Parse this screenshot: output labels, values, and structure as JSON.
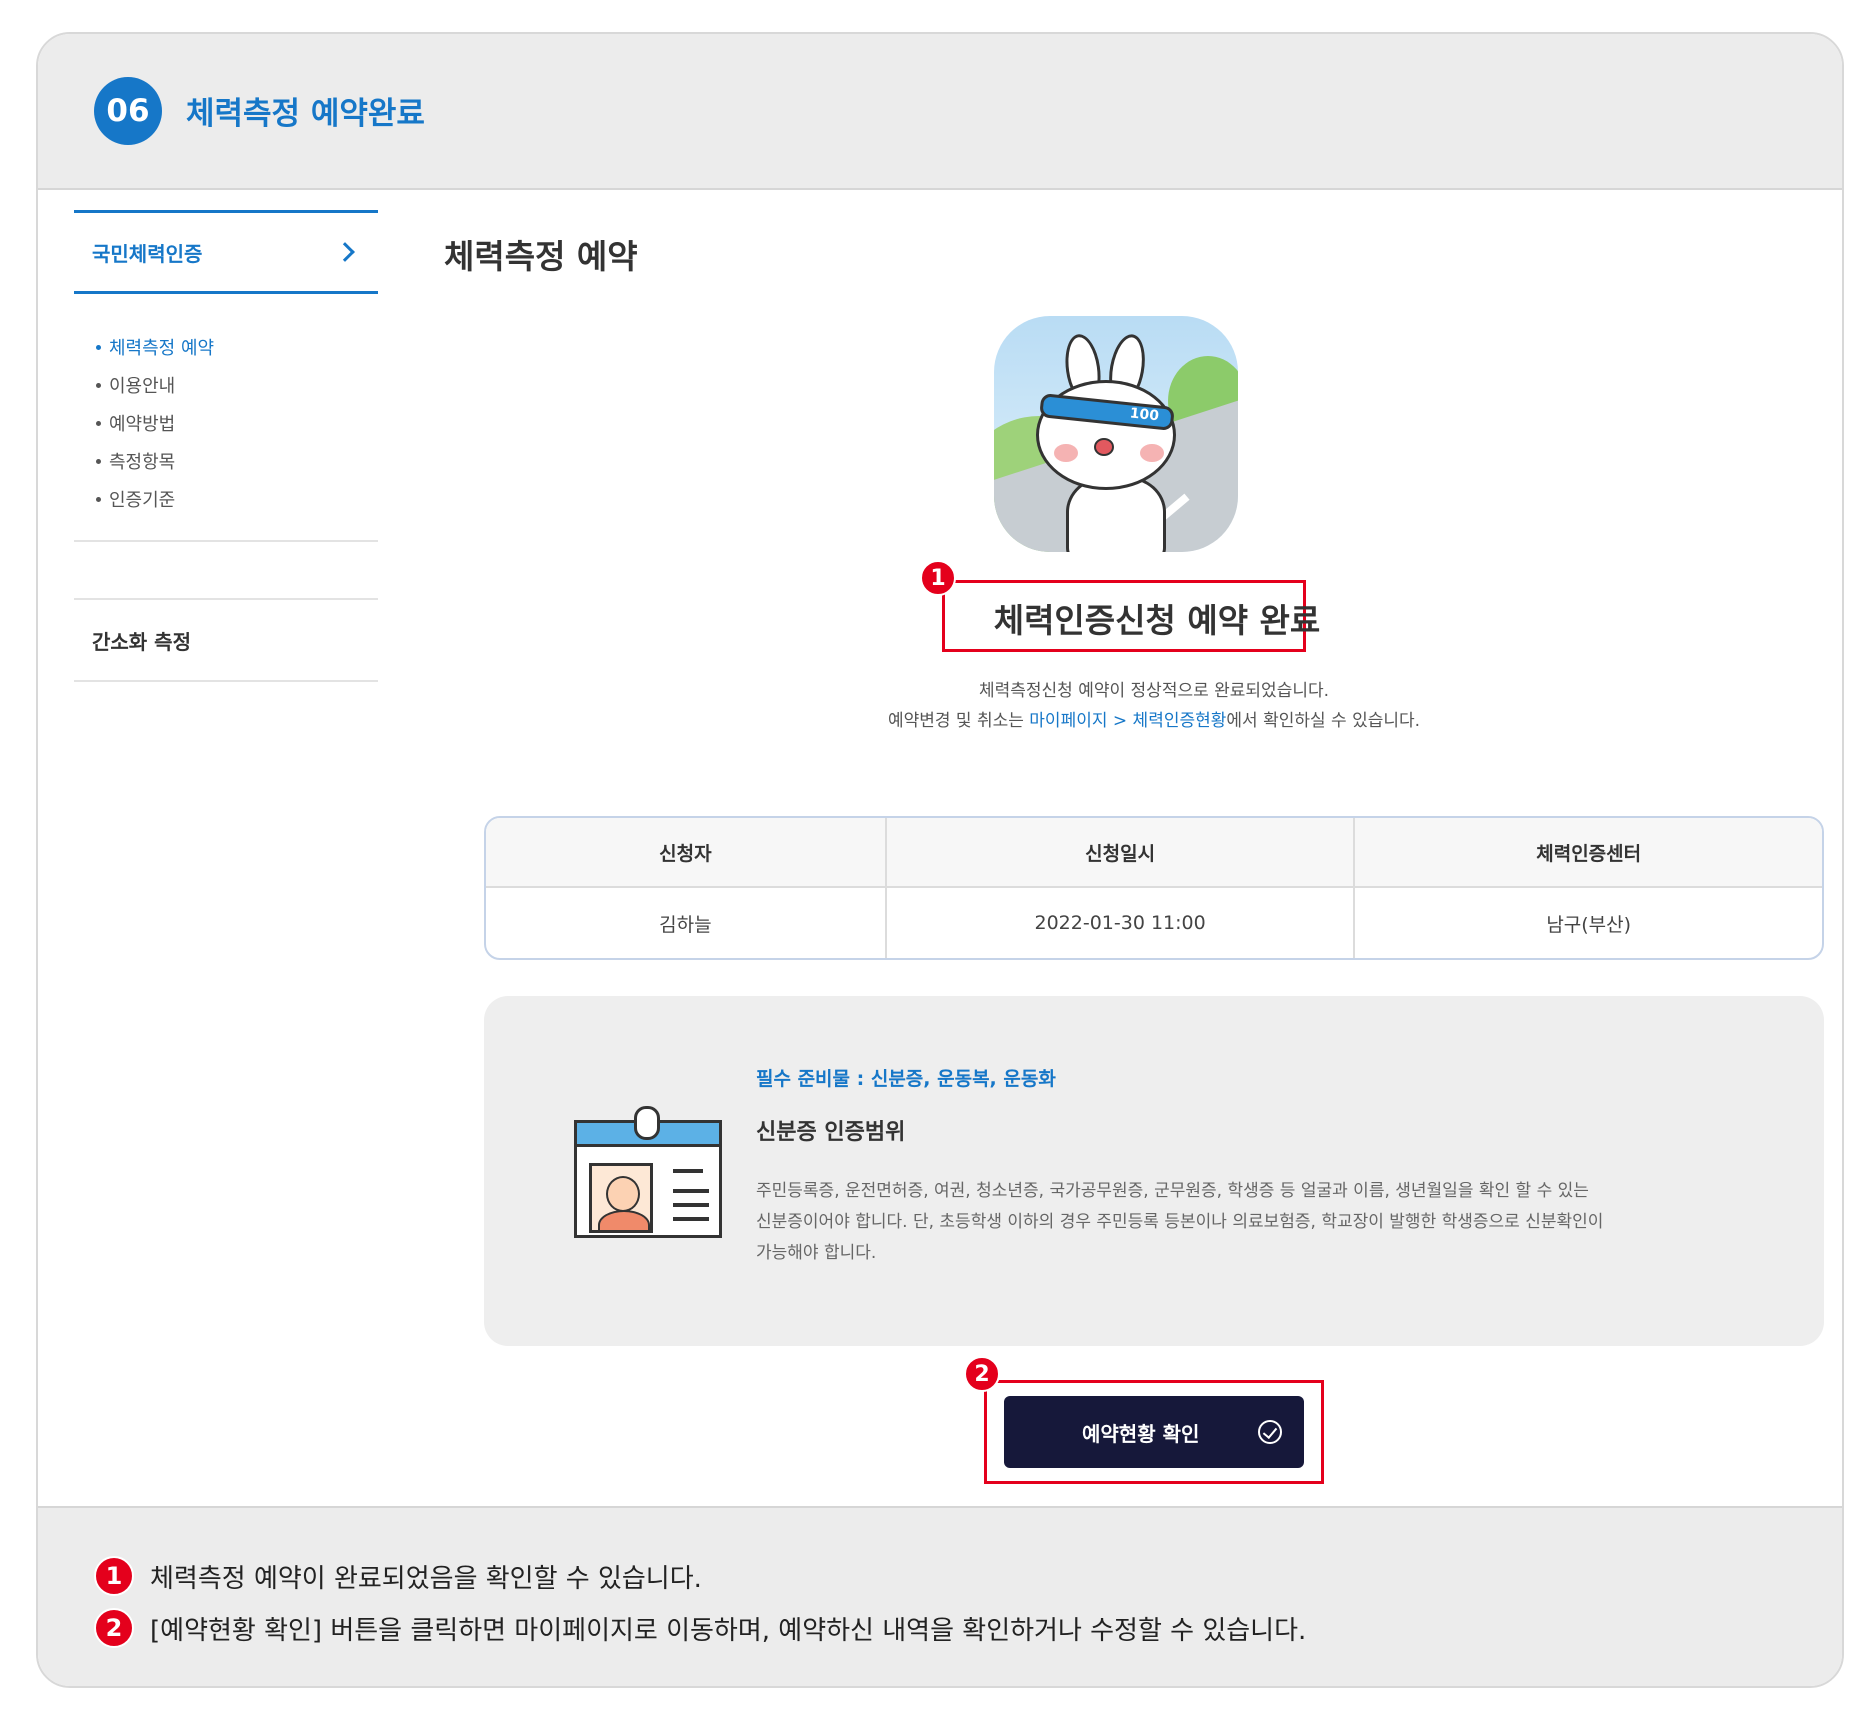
{
  "header": {
    "step_number": "06",
    "title": "체력측정 예약완료"
  },
  "sidebar": {
    "section_title": "국민체력인증",
    "items": [
      {
        "label": "체력측정 예약",
        "active": true
      },
      {
        "label": "이용안내",
        "active": false
      },
      {
        "label": "예약방법",
        "active": false
      },
      {
        "label": "측정항목",
        "active": false
      },
      {
        "label": "인증기준",
        "active": false
      }
    ],
    "section2_title": "간소화 측정"
  },
  "main": {
    "page_title": "체력측정 예약",
    "mascot_band_text": "100",
    "completion_title": "체력인증신청 예약 완료",
    "desc_line1": "체력측정신청 예약이 정상적으로 완료되었습니다.",
    "desc_line2_prefix": "예약변경 및 취소는 ",
    "desc_line2_link": "마이페이지 > 체력인증현황",
    "desc_line2_suffix": "에서 확인하실 수 있습니다.",
    "table": {
      "headers": [
        "신청자",
        "신청일시",
        "체력인증센터"
      ],
      "row": [
        "김하늘",
        "2022-01-30 11:00",
        "남구(부산)"
      ]
    },
    "notice": {
      "required_items": "필수 준비물 : 신분증, 운동복, 운동화",
      "heading": "신분증 인증범위",
      "body_line1": "주민등록증, 운전면허증, 여권, 청소년증, 국가공무원증, 군무원증, 학생증 등 얼굴과 이름, 생년월일을 확인 할 수 있는",
      "body_line2": "신분증이어야 합니다. 단, 초등학생 이하의 경우 주민등록 등본이나 의료보험증, 학교장이 발행한 학생증으로 신분확인이",
      "body_line3": "가능해야 합니다."
    },
    "confirm_button_label": "예약현황 확인"
  },
  "annotations": {
    "badge1": "1",
    "badge2": "2",
    "note1": "체력측정 예약이 완료되었음을 확인할 수 있습니다.",
    "note2": "[예약현황 확인] 버튼을 클릭하면 마이페이지로 이동하며, 예약하신 내역을 확인하거나 수정할 수 있습니다."
  },
  "colors": {
    "accent": "#1677c8",
    "badge_red": "#e4001c",
    "button_dark": "#16183a"
  },
  "icons": {
    "sidebar_arrow": "chevron-right-icon",
    "button_icon": "check-circle-icon"
  }
}
